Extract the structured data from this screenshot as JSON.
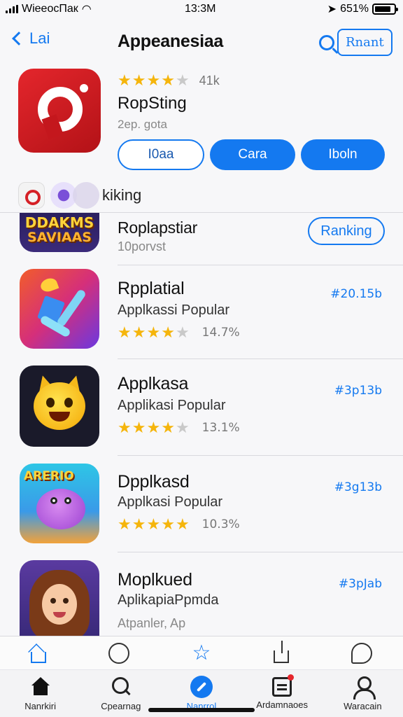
{
  "status_bar": {
    "carrier": "WieeocПак",
    "time": "13:3M",
    "battery_pct": "651%"
  },
  "nav": {
    "back_label": "Lai",
    "title": "Appeanesiaa",
    "right_pill": "Rnant"
  },
  "featured": {
    "rating": 3.5,
    "rating_count": "41k",
    "name": "RopSting",
    "subtitle": "2ep. gota",
    "buttons": [
      "I0aa",
      "Cara",
      "Iboln"
    ]
  },
  "filter": {
    "label": "kiking"
  },
  "apps": [
    {
      "title": "Roplapstiar",
      "meta": "10porvst",
      "action_label": "Ranking",
      "icon_text": [
        "DDAKMS",
        "SAVIAAS"
      ]
    },
    {
      "title": "Rpplatial",
      "subtitle": "Applkassi Popular",
      "rating": 4,
      "rating_pct": "14.7%",
      "price": "#20.15b"
    },
    {
      "title": "Applkasa",
      "subtitle": "Applikasi Popular",
      "rating": 4,
      "rating_pct": "13.1%",
      "price": "#3p13b"
    },
    {
      "title": "Dpplkasd",
      "subtitle": "Applkasi Popular",
      "rating": 4.5,
      "rating_pct": "10.3%",
      "price": "#3g13b",
      "icon_text": "ARERIO"
    },
    {
      "title": "Moplkued",
      "subtitle": "AplikapiaPpmda",
      "meta": "Atpanler, Ap",
      "price": "#3pJab"
    }
  ],
  "tabbar_upper": [
    "home-outline-icon",
    "smile-icon",
    "star-outline-icon",
    "share-icon",
    "chat-icon"
  ],
  "tabbar": [
    {
      "label": "Nanrkiri",
      "icon": "home-icon"
    },
    {
      "label": "Cpearnag",
      "icon": "search-icon"
    },
    {
      "label": "Nanrrol",
      "icon": "compass-icon",
      "active": true
    },
    {
      "label": "Ardamnaoes",
      "icon": "news-icon"
    },
    {
      "label": "Waracain",
      "icon": "person-icon"
    }
  ],
  "colors": {
    "accent": "#1479f0",
    "star": "#f5b50c",
    "brand_red": "#d52026"
  }
}
